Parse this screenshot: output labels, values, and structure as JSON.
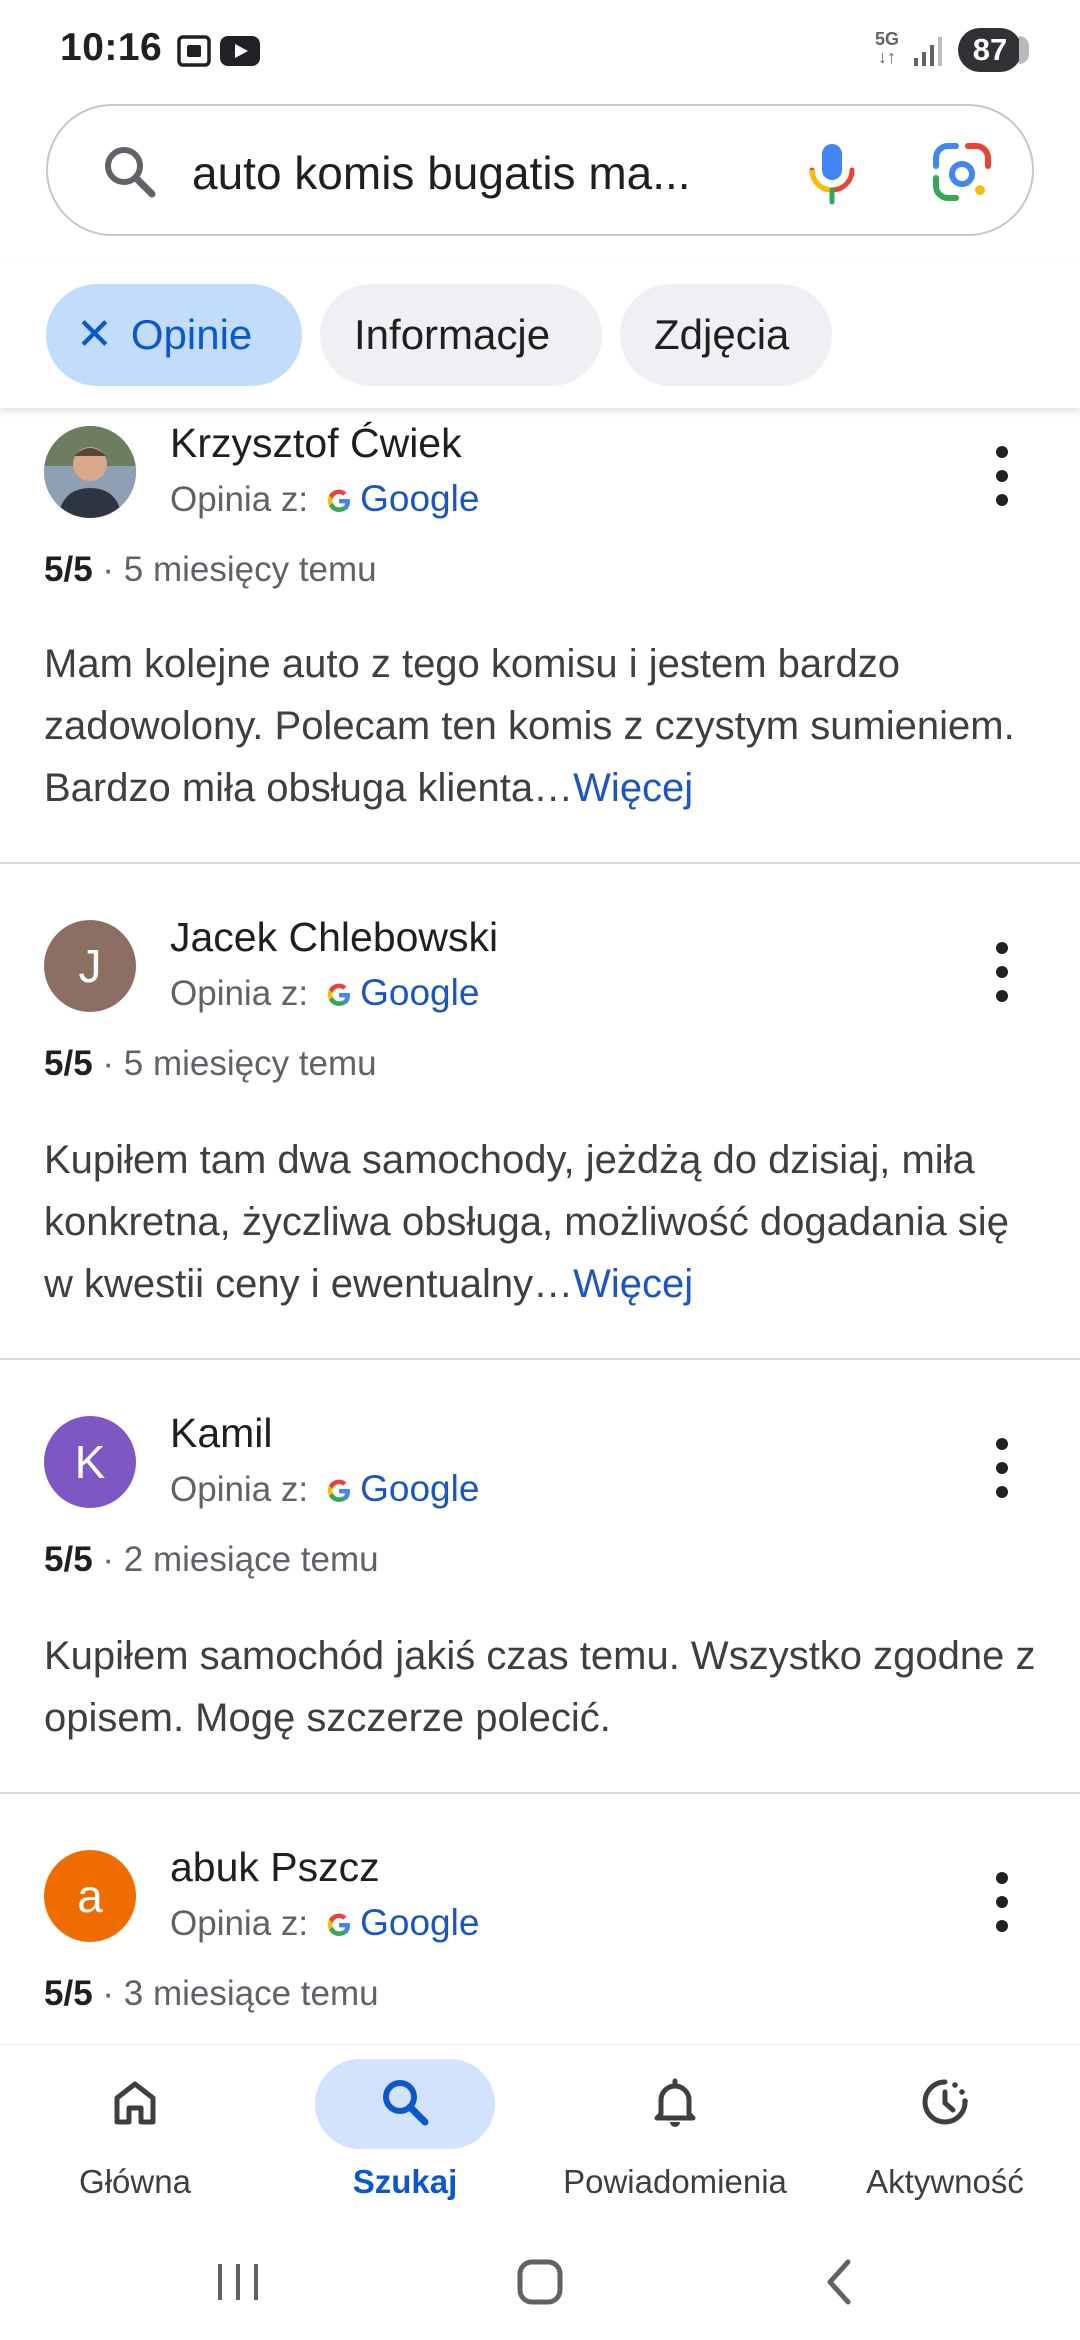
{
  "status_bar": {
    "time": "10:16",
    "battery": "87",
    "network": "5G"
  },
  "search": {
    "query": "auto komis bugatis ma..."
  },
  "chips": [
    {
      "label": "Opinie",
      "active": true
    },
    {
      "label": "Informacje",
      "active": false
    },
    {
      "label": "Zdjęcia",
      "active": false
    }
  ],
  "reviews": [
    {
      "name": "Krzysztof Ćwiek",
      "avatar_letter": "",
      "avatar_color": "#5a6b4a",
      "source_prefix": "Opinia z:",
      "source": "Google",
      "rating": "5/5",
      "separator": "·",
      "time": "5 miesięcy temu",
      "text": "Mam kolejne auto z tego komisu i jestem bardzo zadowolony. Polecam ten komis z czystym sumieniem. Bardzo miła obsługa klienta…",
      "more": "Więcej"
    },
    {
      "name": "Jacek Chlebowski",
      "avatar_letter": "J",
      "avatar_color": "#8d6e63",
      "source_prefix": "Opinia z:",
      "source": "Google",
      "rating": "5/5",
      "separator": "·",
      "time": "5 miesięcy temu",
      "text": "Kupiłem tam dwa samochody, jeżdżą do dzisiaj, miła konkretna, życzliwa obsługa, możliwość dogadania się w kwestii ceny i ewentualny…",
      "more": "Więcej"
    },
    {
      "name": "Kamil",
      "avatar_letter": "K",
      "avatar_color": "#7e57c2",
      "source_prefix": "Opinia z:",
      "source": "Google",
      "rating": "5/5",
      "separator": "·",
      "time": "2 miesiące temu",
      "text": "Kupiłem samochód jakiś czas temu. Wszystko zgodne z opisem. Mogę szczerze polecić.",
      "more": ""
    },
    {
      "name": "abuk Pszcz",
      "avatar_letter": "a",
      "avatar_color": "#ef6c00",
      "source_prefix": "Opinia z:",
      "source": "Google",
      "rating": "5/5",
      "separator": "·",
      "time": "3 miesiące temu",
      "text": "",
      "more": ""
    }
  ],
  "bottom_nav": [
    {
      "label": "Główna",
      "icon": "home-icon",
      "active": false
    },
    {
      "label": "Szukaj",
      "icon": "search-icon",
      "active": true
    },
    {
      "label": "Powiadomienia",
      "icon": "bell-icon",
      "active": false
    },
    {
      "label": "Aktywność",
      "icon": "activity-icon",
      "active": false
    }
  ],
  "colors": {
    "accent": "#0b57d0",
    "chip_active_bg": "#c2dcfc",
    "link": "#1a56c4"
  }
}
